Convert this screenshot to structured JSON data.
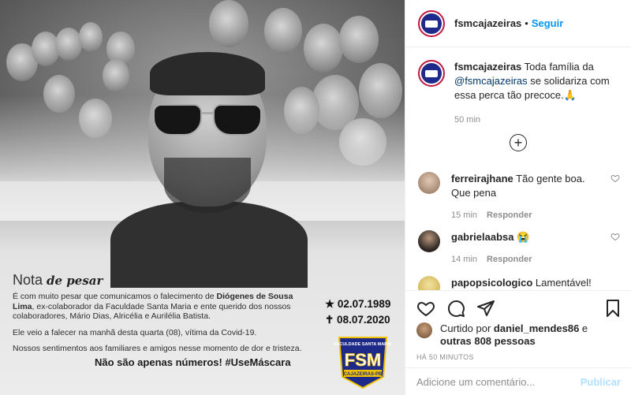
{
  "post": {
    "nota_title": "Nota",
    "nota_title_em": "de pesar",
    "paragraph1_a": "É com muito pesar que comunicamos o falecimento de ",
    "paragraph1_name": "Diógenes de Sousa Lima",
    "paragraph1_b": ", ex-colaborador da Faculdade Santa Maria e ente querido dos nossos colaboradores, Mário Dias, Alricélia e Aurilélia Batista.",
    "paragraph2": "Ele veio a falecer na manhã desta quarta (08), vítima da Covid-19.",
    "paragraph3": "Nossos sentimentos aos familiares e amigos nesse momento de dor e tristeza.",
    "hashtag": "Não são apenas números! #UseMáscara",
    "birth": "★ 02.07.1989",
    "death": "✝ 08.07.2020",
    "logo_top": "FACULDADE SANTA MARIA",
    "logo_main": "FSM",
    "logo_sub": "CAJAZEIRAS-PB"
  },
  "header": {
    "username": "fsmcajazeiras",
    "dot": "•",
    "follow_label": "Seguir"
  },
  "caption": {
    "username": "fsmcajazeiras",
    "text_a": " Toda família da ",
    "mention": "@fsmcajazeiras",
    "text_b": " se solidariza com essa perca tão precoce.🙏",
    "time": "50 min"
  },
  "load_more_icon": "+",
  "comments": [
    {
      "username": "ferreirajhane",
      "text": " Tão gente boa. Que pena",
      "time": "15 min",
      "reply": "Responder"
    },
    {
      "username": "gabrielaabsa",
      "text": " 😭",
      "time": "14 min",
      "reply": "Responder"
    },
    {
      "username": "papopsicologico",
      "text": " Lamentável! Que"
    }
  ],
  "likes": {
    "prefix": "Curtido por ",
    "user": "daniel_mendes86",
    "middle": " e",
    "others": "outras 808 pessoas"
  },
  "timestamp": "HÁ 50 MINUTOS",
  "comment_box": {
    "placeholder": "Adicione um comentário...",
    "publish_label": "Publicar"
  },
  "colors": {
    "accent_blue": "#0095f6",
    "publish_disabled": "#b2dffc",
    "avatar_ring": "#c0183f",
    "logo_blue": "#1e2a8a",
    "logo_yellow": "#f2c200"
  },
  "icons": [
    "heart-icon",
    "comment-icon",
    "share-icon",
    "bookmark-icon",
    "plus-circle-icon"
  ]
}
